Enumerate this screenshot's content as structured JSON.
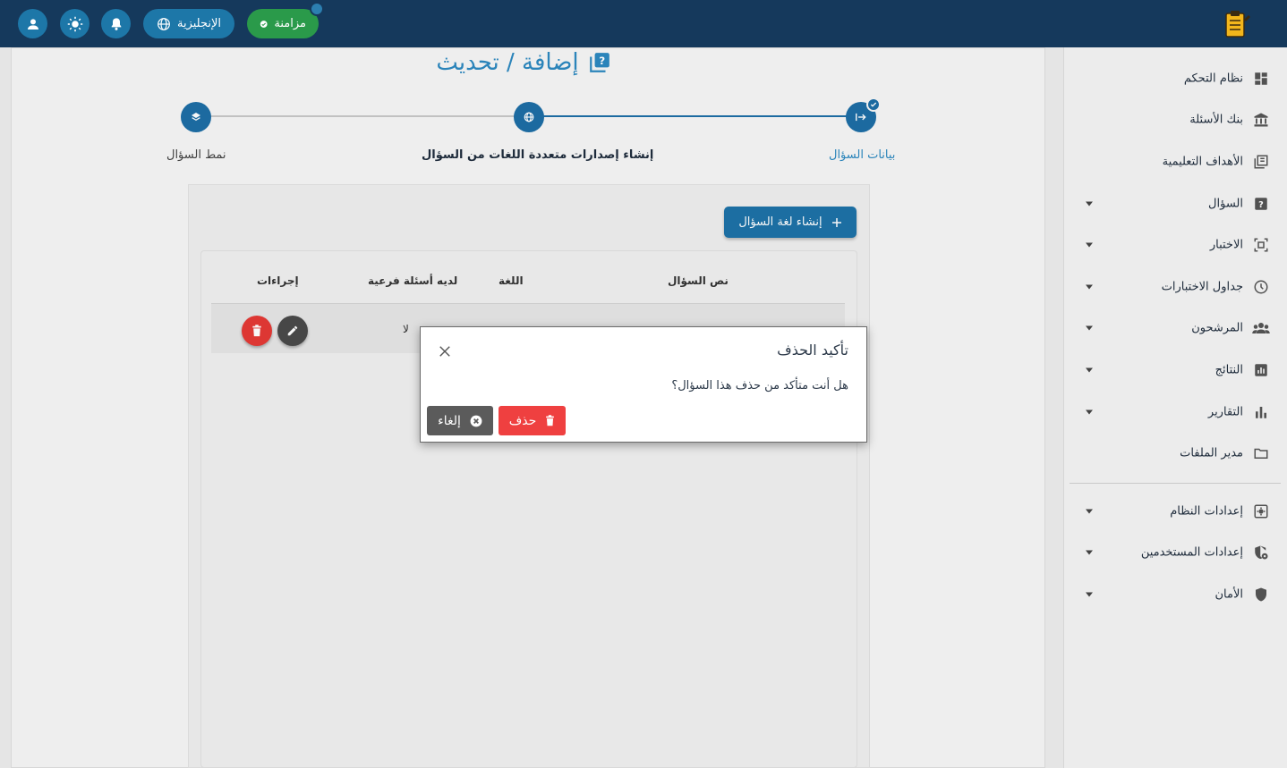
{
  "topbar": {
    "language_label": "الإنجليزية",
    "sync_label": "مزامنة"
  },
  "sidebar": {
    "items": [
      {
        "label": "نظام التحكم",
        "icon": "dashboard-icon"
      },
      {
        "label": "بنك الأسئلة",
        "icon": "bank-icon"
      },
      {
        "label": "الأهداف التعليمية",
        "icon": "objectives-icon"
      },
      {
        "label": "السؤال",
        "icon": "question-icon"
      },
      {
        "label": "الاختبار",
        "icon": "exam-icon"
      },
      {
        "label": "جداول الاختبارات",
        "icon": "clock-icon"
      },
      {
        "label": "المرشحون",
        "icon": "candidates-icon"
      },
      {
        "label": "النتائج",
        "icon": "results-icon"
      },
      {
        "label": "التقارير",
        "icon": "reports-icon"
      },
      {
        "label": "مدير الملفات",
        "icon": "folder-icon"
      },
      {
        "label": "إعدادات النظام",
        "icon": "system-settings-icon"
      },
      {
        "label": "إعدادات المستخدمين",
        "icon": "user-settings-icon"
      },
      {
        "label": "الأمان",
        "icon": "shield-icon"
      }
    ]
  },
  "page": {
    "title": "إضافة / تحديث"
  },
  "stepper": {
    "steps": [
      {
        "label": "بيانات السؤال",
        "state": "completed"
      },
      {
        "label": "إنشاء إصدارات متعددة اللغات من السؤال",
        "state": "active"
      },
      {
        "label": "نمط السؤال",
        "state": "pending"
      }
    ]
  },
  "toolbar": {
    "create_label": "إنشاء لغة السؤال"
  },
  "table": {
    "headers": {
      "question_text": "نص السؤال",
      "language": "اللغة",
      "has_subquestions": "لديه أسئلة فرعية",
      "actions": "إجراءات"
    },
    "rows": [
      {
        "has_subquestions": "لا"
      }
    ]
  },
  "dialog": {
    "title": "تأكيد الحذف",
    "message": "هل أنت متأكد من حذف هذا السؤال؟",
    "delete_label": "حذف",
    "cancel_label": "إلغاء"
  },
  "colors": {
    "topbar": "#15395c",
    "primary": "#1d72a8",
    "danger": "#ef4040",
    "success": "#2a9a4a"
  }
}
